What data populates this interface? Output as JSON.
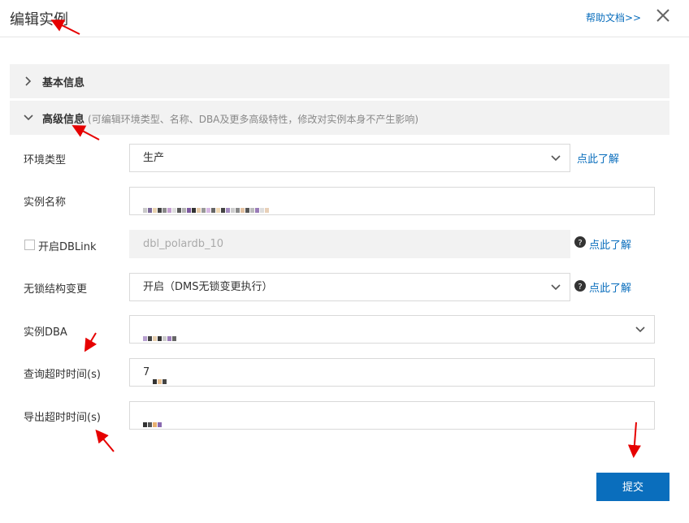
{
  "header": {
    "title": "编辑实例",
    "help_link": "帮助文档>>",
    "close_icon": "close-icon"
  },
  "sections": {
    "basic": {
      "title": "基本信息",
      "icon": "chevron-right-icon"
    },
    "advanced": {
      "title": "高级信息",
      "hint": "(可编辑环境类型、名称、DBA及更多高级特性，修改对实例本身不产生影响)",
      "icon": "chevron-down-icon"
    }
  },
  "form": {
    "env_type": {
      "label": "环境类型",
      "value": "生产",
      "help": "点此了解"
    },
    "instance_name": {
      "label": "实例名称",
      "value": ""
    },
    "dblink": {
      "label": "开启DBLink",
      "placeholder": "dbl_polardb_10",
      "checked": false,
      "help": "点此了解"
    },
    "lockless": {
      "label": "无锁结构变更",
      "value": "开启（DMS无锁变更执行）",
      "help": "点此了解"
    },
    "dba": {
      "label": "实例DBA",
      "value": ""
    },
    "query_timeout": {
      "label": "查询超时时间(s)",
      "value": "7"
    },
    "export_timeout": {
      "label": "导出超时时间(s)",
      "value": ""
    }
  },
  "submit_label": "提交",
  "colors": {
    "accent": "#0a6ebd",
    "annotation": "#e60000",
    "section_bg": "#f2f2f2"
  }
}
